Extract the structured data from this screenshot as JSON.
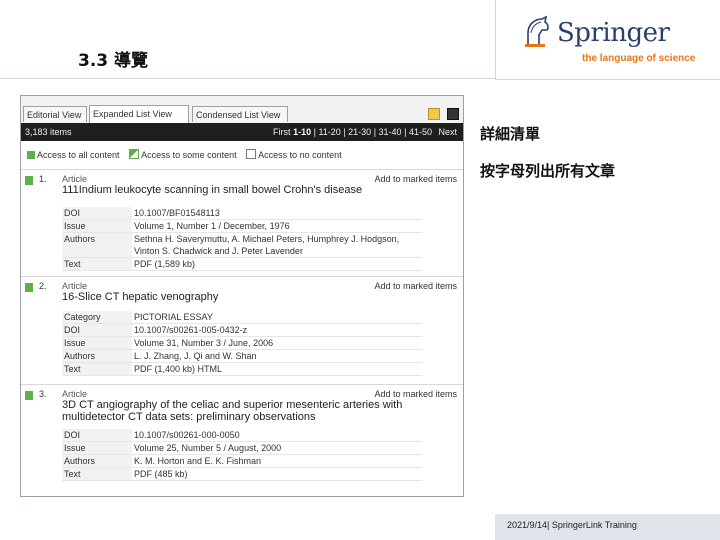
{
  "slide": {
    "title": "3.3 導覽",
    "notes": [
      "詳細清單",
      "按字母列出所有文章"
    ],
    "footer": "2021/9/14| SpringerLink Training"
  },
  "logo": {
    "wordmark": "Springer",
    "tagline": "the language of science",
    "colors": {
      "wordmark": "#2a3f6a",
      "tagline": "#e8751a"
    }
  },
  "tabs": [
    {
      "label": "Editorial View"
    },
    {
      "label": "Expanded List View"
    },
    {
      "label": "Condensed List View"
    }
  ],
  "toolbar": {
    "count": "3,183 items",
    "pager": {
      "first": "First",
      "current": "1-10",
      "pages": [
        "11-20",
        "21-30",
        "31-40",
        "41-50"
      ],
      "next": "Next"
    }
  },
  "legend": {
    "all": "Access to all content",
    "some": "Access to some content",
    "none": "Access to no content",
    "colors": {
      "all": "#5db04a",
      "some": "#8ccf5a"
    }
  },
  "results": [
    {
      "number": "1.",
      "type": "Article",
      "add": "Add to marked items",
      "title": "111Indium leukocyte scanning in small bowel Crohn's disease",
      "rows": [
        {
          "k": "DOI",
          "v": "10.1007/BF01548113"
        },
        {
          "k": "Issue",
          "v": "Volume 1, Number 1 / December, 1976"
        },
        {
          "k": "Authors",
          "v": "Sethna H. Saverymuttu, A. Michael Peters, Humphrey J. Hodgson, Vinton S. Chadwick and J. Peter Lavender"
        },
        {
          "k": "Text",
          "v": "PDF (1,589 kb)"
        }
      ]
    },
    {
      "number": "2.",
      "type": "Article",
      "add": "Add to marked items",
      "title": "16-Slice CT hepatic venography",
      "rows": [
        {
          "k": "Category",
          "v": "PICTORIAL ESSAY"
        },
        {
          "k": "DOI",
          "v": "10.1007/s00261-005-0432-z"
        },
        {
          "k": "Issue",
          "v": "Volume 31, Number 3 / June, 2006"
        },
        {
          "k": "Authors",
          "v": "L. J. Zhang, J. Qi and W. Shan"
        },
        {
          "k": "Text",
          "v": "PDF (1,400 kb) HTML"
        }
      ]
    },
    {
      "number": "3.",
      "type": "Article",
      "add": "Add to marked items",
      "title": "3D CT angiography of the celiac and superior mesenteric arteries with multidetector CT data sets: preliminary observations",
      "rows": [
        {
          "k": "DOI",
          "v": "10.1007/s00261-000-0050"
        },
        {
          "k": "Issue",
          "v": "Volume 25, Number 5 / August, 2000"
        },
        {
          "k": "Authors",
          "v": "K. M. Horton and E. K. Fishman"
        },
        {
          "k": "Text",
          "v": "PDF (485 kb)"
        }
      ]
    }
  ]
}
